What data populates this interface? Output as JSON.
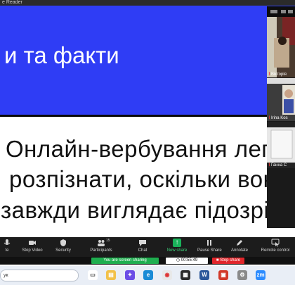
{
  "window": {
    "title_fragment": "e Reader"
  },
  "slide": {
    "title": "и та факти",
    "lines": [
      "Онлайн-вербування легк",
      "розпізнати, оскільки воно",
      "завжди виглядає підозріло."
    ],
    "colors": {
      "header_bg": "#2f3df5",
      "body_bg": "#ffffff"
    }
  },
  "participants_panel": {
    "tiles": [
      {
        "name": "Вікторія"
      },
      {
        "name": "Irina Kos"
      },
      {
        "name": "Ганна С"
      }
    ]
  },
  "toolbar": {
    "items": [
      {
        "label": "te",
        "icon": "mic-icon"
      },
      {
        "label": "Stop Video",
        "icon": "video-icon"
      },
      {
        "label": "Security",
        "icon": "shield-icon"
      },
      {
        "label": "Participants",
        "icon": "participants-icon",
        "count": "15"
      },
      {
        "label": "Chat",
        "icon": "chat-icon"
      },
      {
        "label": "New share",
        "icon": "share-icon",
        "accent": true
      },
      {
        "label": "Pause Share",
        "icon": "pause-icon"
      },
      {
        "label": "Annotate",
        "icon": "annotate-icon"
      },
      {
        "label": "Remote control",
        "icon": "remote-control-icon"
      }
    ]
  },
  "share_bar": {
    "status": "You are screen sharing",
    "timer": "00:55:49",
    "stop_label": "Stop share"
  },
  "taskbar": {
    "search_placeholder": "ук",
    "apps": [
      "file-explorer-icon",
      "copilot-icon",
      "edge-icon",
      "chrome-icon",
      "files-icon",
      "store-icon",
      "word-icon",
      "zoom-icon"
    ]
  }
}
